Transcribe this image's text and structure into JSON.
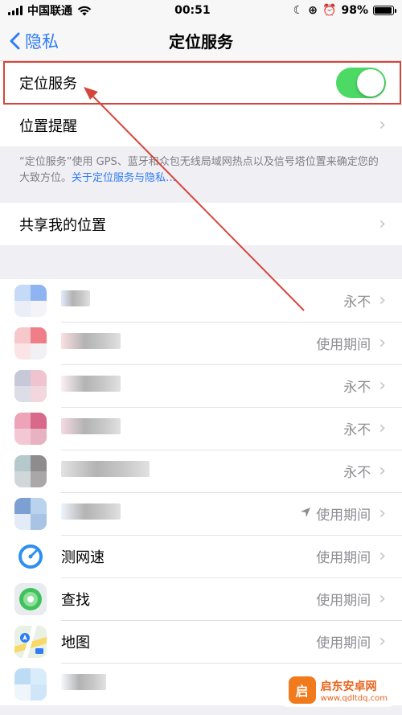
{
  "status": {
    "carrier": "中国联通",
    "time": "00:51",
    "battery": "98%",
    "battery_level": 0.98
  },
  "nav": {
    "back_label": "隐私",
    "title": "定位服务"
  },
  "location_toggle": {
    "label": "定位服务",
    "on": true
  },
  "location_alerts": {
    "label": "位置提醒"
  },
  "note": {
    "text": "“定位服务”使用 GPS、蓝牙和众包无线局域网热点以及信号塔位置来确定您的大致方位。",
    "link": "关于定位服务与隐私…"
  },
  "share": {
    "label": "共享我的位置"
  },
  "apps": [
    {
      "name": "",
      "permission": "永不",
      "blurred": true,
      "arrow": false,
      "colors": [
        "#c5daf7",
        "#8fb4f2",
        "#e9eef9",
        "#f3f3f8"
      ],
      "name_width": 36
    },
    {
      "name": "",
      "permission": "使用期间",
      "blurred": true,
      "arrow": false,
      "colors": [
        "#f6c7cb",
        "#f07e88",
        "#fbe4e6",
        "#f1f1f4"
      ],
      "name_width": 74
    },
    {
      "name": "",
      "permission": "永不",
      "blurred": true,
      "arrow": false,
      "colors": [
        "#c8c9d8",
        "#f0c3d0",
        "#dcdde6",
        "#f3d7df"
      ],
      "name_width": 74
    },
    {
      "name": "",
      "permission": "永不",
      "blurred": true,
      "arrow": false,
      "colors": [
        "#eda4b9",
        "#d8698b",
        "#f4c7d4",
        "#e7b3c2"
      ],
      "name_width": 74
    },
    {
      "name": "",
      "permission": "永不",
      "blurred": true,
      "arrow": false,
      "colors": [
        "#b5c9cc",
        "#8e8c8c",
        "#cfd7d8",
        "#a9a7a8"
      ],
      "name_width": 110
    },
    {
      "name": "",
      "permission": "使用期间",
      "blurred": true,
      "arrow": true,
      "colors": [
        "#7da0d2",
        "#b9d3ef",
        "#e3ecf6",
        "#a8c3e3"
      ],
      "name_width": 74
    },
    {
      "name": "测网速",
      "permission": "使用期间",
      "blurred": false,
      "arrow": false,
      "icon": "speedtest-icon"
    },
    {
      "name": "查找",
      "permission": "使用期间",
      "blurred": false,
      "arrow": false,
      "icon": "find-my-icon"
    },
    {
      "name": "地图",
      "permission": "使用期间",
      "blurred": false,
      "arrow": false,
      "icon": "maps-icon"
    },
    {
      "name": "",
      "permission": "",
      "blurred": true,
      "arrow": false,
      "colors": [
        "#bcdcf6",
        "#d9ecfa",
        "#eef6fc",
        "#cfe6f8"
      ],
      "name_width": 56
    }
  ],
  "watermark": {
    "title": "启东安卓网",
    "url": "www.qdltdq.com",
    "logo": "启"
  },
  "colors": {
    "accent": "#2f7cf6",
    "toggle_on": "#4cd964",
    "annotation": "#d6453a"
  }
}
